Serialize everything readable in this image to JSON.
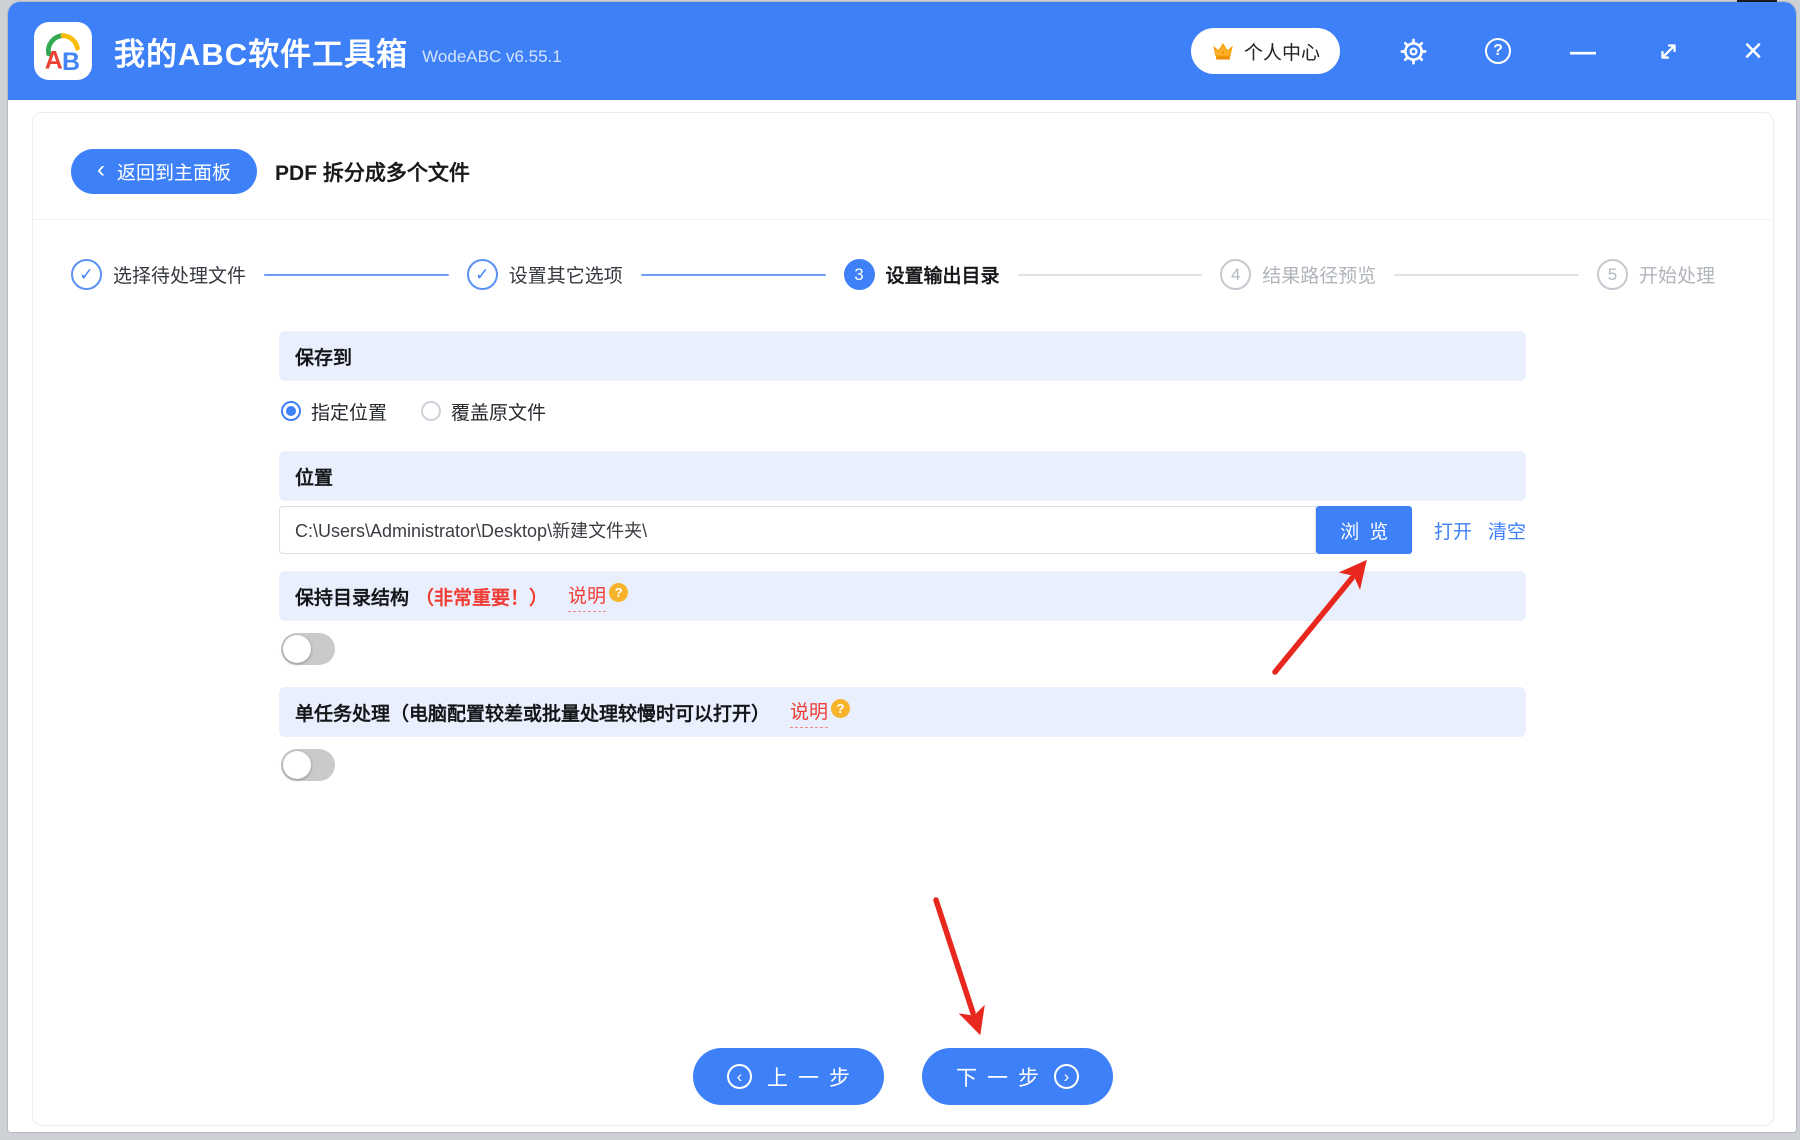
{
  "titlebar": {
    "app_title": "我的ABC软件工具箱",
    "version": "WodeABC v6.55.1",
    "personal_center_label": "个人中心",
    "icons": {
      "minimize": "—",
      "close": "×",
      "help": "?"
    }
  },
  "toolbar": {
    "back_chevron": "‹",
    "back_label": "返回到主面板",
    "page_title": "PDF 拆分成多个文件"
  },
  "steps": [
    {
      "label": "选择待处理文件",
      "status": "done",
      "icon": "✓"
    },
    {
      "label": "设置其它选项",
      "status": "done",
      "icon": "✓"
    },
    {
      "label": "设置输出目录",
      "status": "current",
      "number": "3"
    },
    {
      "label": "结果路径预览",
      "status": "todo",
      "number": "4"
    },
    {
      "label": "开始处理",
      "status": "todo",
      "number": "5"
    }
  ],
  "form": {
    "save_to": {
      "title": "保存到",
      "option_specified": "指定位置",
      "option_overwrite": "覆盖原文件",
      "selected": "指定位置"
    },
    "location": {
      "title": "位置",
      "path": "C:\\Users\\Administrator\\Desktop\\新建文件夹\\",
      "browse_label": "浏览",
      "open_label": "打开",
      "clear_label": "清空"
    },
    "keep_structure": {
      "title": "保持目录结构",
      "important_note": "（非常重要！）",
      "help_label": "说明",
      "help_badge": "?",
      "enabled": false
    },
    "single_task": {
      "title": "单任务处理（电脑配置较差或批量处理较慢时可以打开）",
      "help_label": "说明",
      "help_badge": "?",
      "enabled": false
    }
  },
  "footer": {
    "prev_icon": "‹",
    "prev_label": "上一步",
    "next_label": "下一步",
    "next_icon": "›"
  },
  "colors": {
    "accent": "#3e80f7",
    "band_bg": "#e9effc",
    "danger_red": "#f03c35",
    "arrow_red": "#e8281e",
    "badge_orange": "#f7b32b"
  }
}
